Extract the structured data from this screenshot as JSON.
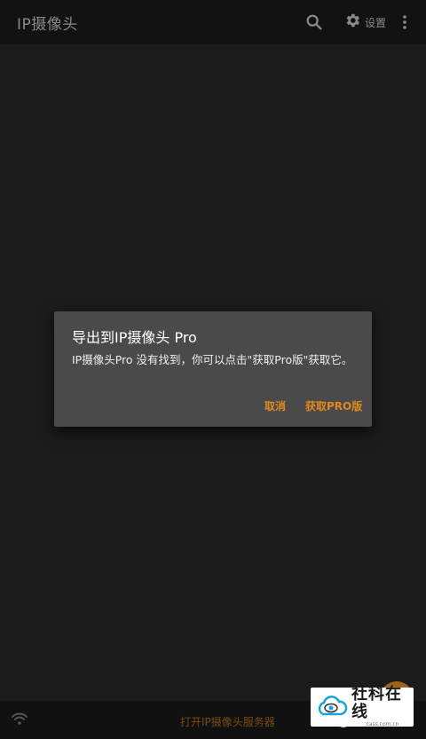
{
  "appbar": {
    "title": "IP摄像头",
    "search_icon": "search-icon",
    "settings_icon": "gear-icon",
    "settings_label": "设置",
    "more_icon": "more-vert-icon"
  },
  "dialog": {
    "title": "导出到IP摄像头 Pro",
    "message": "IP摄像头Pro 没有找到，你可以点击\"获取Pro版\"获取它。",
    "cancel_label": "取消",
    "get_pro_label": "获取PRO版"
  },
  "bottombar": {
    "wifi_icon": "wifi-icon",
    "start_server_label": "打开IP摄像头服务器"
  },
  "watermark": {
    "name": "社科在线",
    "sub": "cass.com.cn"
  },
  "colors": {
    "accent": "#e08a1e",
    "dialog_bg": "#4a4a4a",
    "appbar_bg": "#121212"
  }
}
